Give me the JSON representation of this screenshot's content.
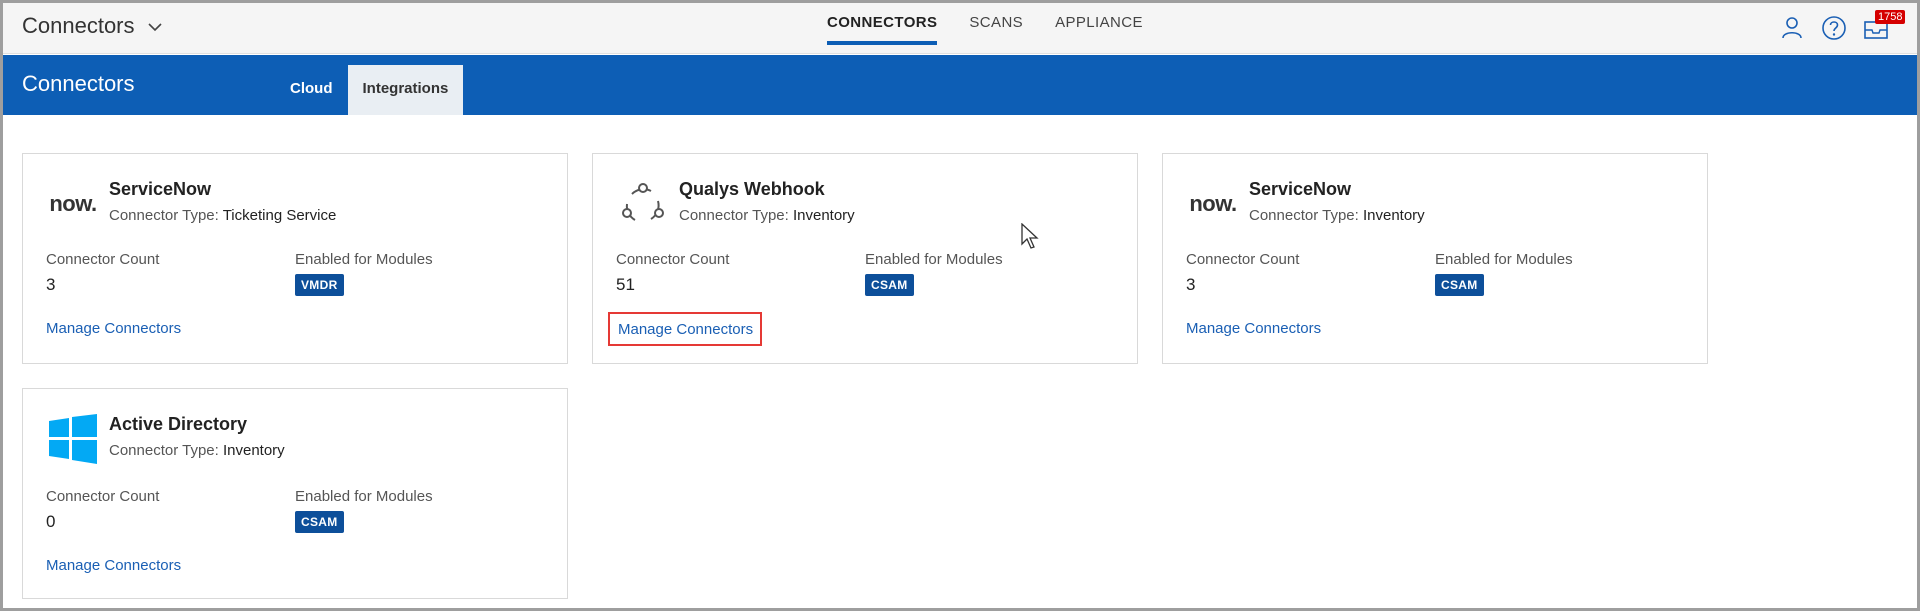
{
  "header": {
    "app_title": "Connectors",
    "nav": [
      {
        "label": "CONNECTORS",
        "active": true
      },
      {
        "label": "SCANS",
        "active": false
      },
      {
        "label": "APPLIANCE",
        "active": false
      }
    ],
    "notification_count": "1758"
  },
  "band": {
    "title": "Connectors",
    "tabs": [
      {
        "label": "Cloud",
        "active": false
      },
      {
        "label": "Integrations",
        "active": true
      }
    ]
  },
  "labels": {
    "connector_type": "Connector Type:",
    "connector_count": "Connector Count",
    "enabled_for_modules": "Enabled for Modules",
    "manage_connectors": "Manage Connectors"
  },
  "cards": [
    {
      "name": "ServiceNow",
      "type": "Ticketing Service",
      "count": "3",
      "module": "VMDR",
      "logo": "servicenow-logo",
      "logo_text": "now."
    },
    {
      "name": "Qualys Webhook",
      "type": "Inventory",
      "count": "51",
      "module": "CSAM",
      "logo": "webhook-icon"
    },
    {
      "name": "ServiceNow",
      "type": "Inventory",
      "count": "3",
      "module": "CSAM",
      "logo": "servicenow-logo",
      "logo_text": "now."
    },
    {
      "name": "Active Directory",
      "type": "Inventory",
      "count": "0",
      "module": "CSAM",
      "logo": "windows-logo"
    }
  ],
  "colors": {
    "brand_blue": "#0d5eb5",
    "module_badge": "#0d4f9a",
    "link": "#1a5fb4",
    "highlight": "#e53935",
    "notification_badge": "#d50000",
    "windows_blue": "#03a9f4"
  }
}
